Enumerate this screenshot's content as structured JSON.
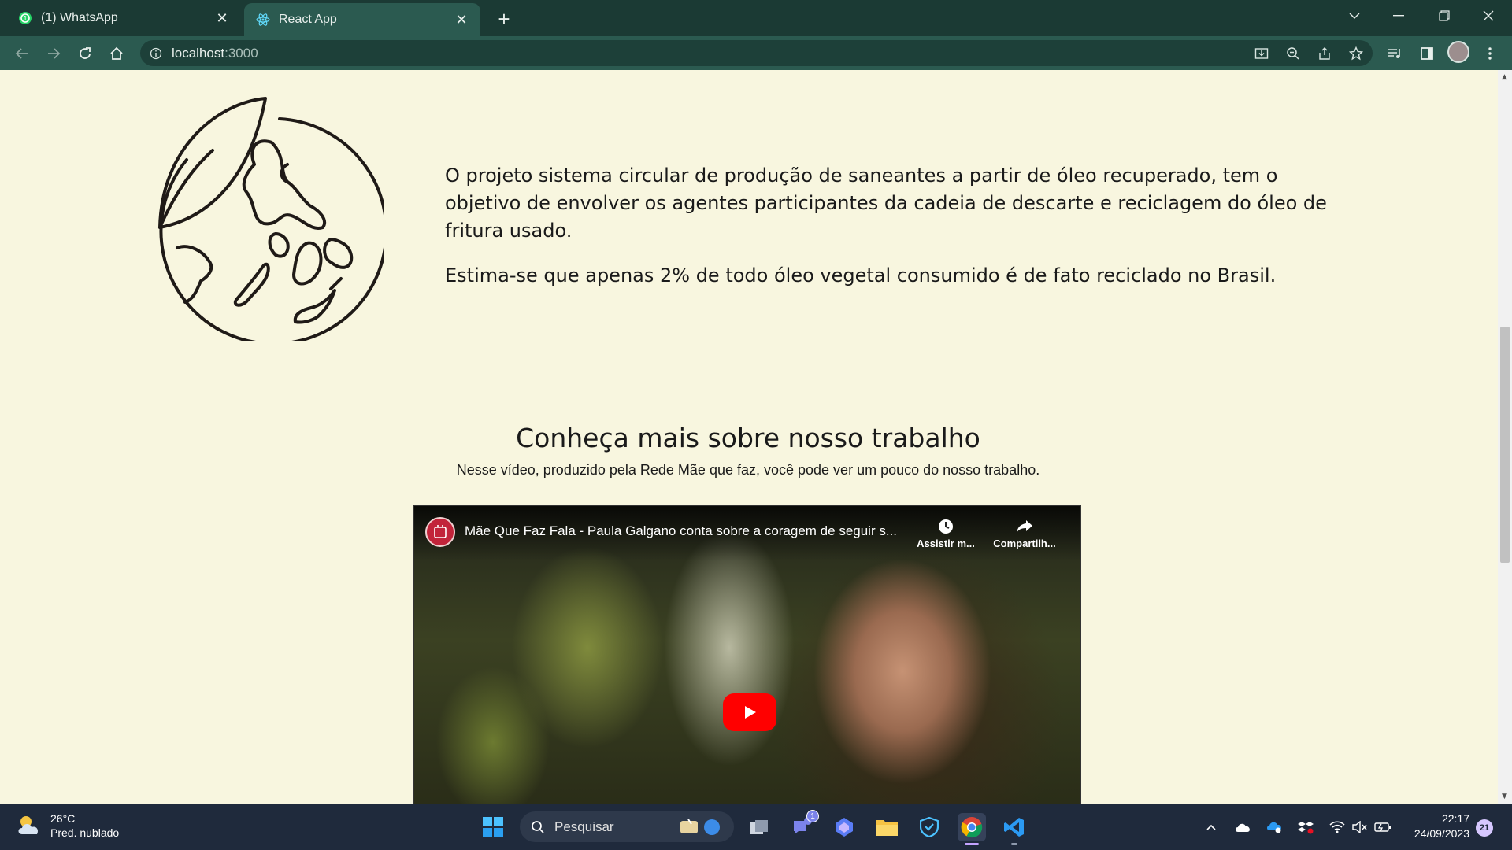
{
  "browser": {
    "tabs": [
      {
        "title": "(1) WhatsApp",
        "icon": "whatsapp-icon",
        "active": false
      },
      {
        "title": "React App",
        "icon": "react-icon",
        "active": true
      }
    ],
    "url_host": "localhost",
    "url_port": ":3000",
    "colors": {
      "tabbar": "#1b3a34",
      "toolbar": "#2b5a50"
    }
  },
  "page": {
    "background": "#f8f6df",
    "intro": {
      "paragraph1": "O projeto sistema circular de produção de saneantes a partir de óleo recuperado, tem o objetivo de envolver os agentes participantes da cadeia de descarte e reciclagem do óleo de fritura usado.",
      "paragraph2": "Estima-se que apenas 2% de todo óleo vegetal consumido é de fato reciclado no Brasil."
    },
    "section": {
      "title": "Conheça mais sobre nosso trabalho",
      "subtitle": "Nesse vídeo, produzido pela Rede Mãe que faz, você pode ver um pouco do nosso trabalho."
    },
    "video": {
      "title": "Mãe Que Faz Fala - Paula Galgano conta sobre a coragem de seguir s...",
      "watch_later": "Assistir m...",
      "share": "Compartilh..."
    }
  },
  "taskbar": {
    "weather_temp": "26°C",
    "weather_desc": "Pred. nublado",
    "search_placeholder": "Pesquisar",
    "teams_badge": "1",
    "time": "22:17",
    "date": "24/09/2023",
    "notifications": "21"
  }
}
